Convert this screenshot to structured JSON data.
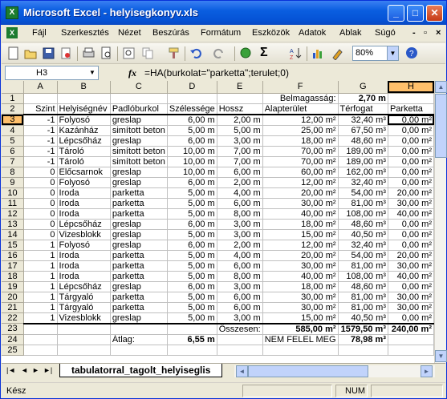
{
  "window": {
    "title": "Microsoft Excel - helyisegkonyv.xls",
    "app_icon": "X"
  },
  "caption_buttons": {
    "minimize": "_",
    "maximize": "□",
    "close": "✕"
  },
  "menu": [
    {
      "label": "Fájl"
    },
    {
      "label": "Szerkesztés"
    },
    {
      "label": "Nézet"
    },
    {
      "label": "Beszúrás"
    },
    {
      "label": "Formátum"
    },
    {
      "label": "Eszközök"
    },
    {
      "label": "Adatok"
    },
    {
      "label": "Ablak"
    },
    {
      "label": "Súgó"
    }
  ],
  "menu_right": {
    "minimize": "-",
    "restore": "▫",
    "close": "×"
  },
  "toolbar": {
    "zoom": "80%",
    "sum_symbol": "Σ"
  },
  "formula_bar": {
    "name_box": "H3",
    "fx": "fx",
    "formula": "=HA(burkolat=\"parketta\";terulet;0)"
  },
  "columns": [
    "A",
    "B",
    "C",
    "D",
    "E",
    "F",
    "G",
    "H"
  ],
  "selected_cell": {
    "row": 3,
    "col": "H"
  },
  "rows": [
    {
      "n": "1",
      "cells": [
        "",
        "",
        "",
        "",
        "",
        "Belmagasság:",
        "2,70 m",
        ""
      ]
    },
    {
      "n": "2",
      "cells": [
        "Szint",
        "Helyiségnév",
        "Padlóburkol",
        "Szélessége",
        "Hossz",
        "Alapterület",
        "Térfogat",
        "Parketta"
      ]
    },
    {
      "n": "3",
      "cells": [
        "-1",
        "Folyosó",
        "greslap",
        "6,00 m",
        "2,00 m",
        "12,00 m²",
        "32,40 m³",
        "0,00 m²"
      ]
    },
    {
      "n": "4",
      "cells": [
        "-1",
        "Kazánház",
        "simított beton",
        "5,00 m",
        "5,00 m",
        "25,00 m²",
        "67,50 m³",
        "0,00 m²"
      ]
    },
    {
      "n": "5",
      "cells": [
        "-1",
        "Lépcsőház",
        "greslap",
        "6,00 m",
        "3,00 m",
        "18,00 m²",
        "48,60 m³",
        "0,00 m²"
      ]
    },
    {
      "n": "6",
      "cells": [
        "-1",
        "Tároló",
        "simított beton",
        "10,00 m",
        "7,00 m",
        "70,00 m²",
        "189,00 m³",
        "0,00 m²"
      ]
    },
    {
      "n": "7",
      "cells": [
        "-1",
        "Tároló",
        "simított beton",
        "10,00 m",
        "7,00 m",
        "70,00 m²",
        "189,00 m³",
        "0,00 m²"
      ]
    },
    {
      "n": "8",
      "cells": [
        "0",
        "Előcsarnok",
        "greslap",
        "10,00 m",
        "6,00 m",
        "60,00 m²",
        "162,00 m³",
        "0,00 m²"
      ]
    },
    {
      "n": "9",
      "cells": [
        "0",
        "Folyosó",
        "greslap",
        "6,00 m",
        "2,00 m",
        "12,00 m²",
        "32,40 m³",
        "0,00 m²"
      ]
    },
    {
      "n": "10",
      "cells": [
        "0",
        "Iroda",
        "parketta",
        "5,00 m",
        "4,00 m",
        "20,00 m²",
        "54,00 m³",
        "20,00 m²"
      ]
    },
    {
      "n": "11",
      "cells": [
        "0",
        "Iroda",
        "parketta",
        "5,00 m",
        "6,00 m",
        "30,00 m²",
        "81,00 m³",
        "30,00 m²"
      ]
    },
    {
      "n": "12",
      "cells": [
        "0",
        "Iroda",
        "parketta",
        "5,00 m",
        "8,00 m",
        "40,00 m²",
        "108,00 m³",
        "40,00 m²"
      ]
    },
    {
      "n": "13",
      "cells": [
        "0",
        "Lépcsőház",
        "greslap",
        "6,00 m",
        "3,00 m",
        "18,00 m²",
        "48,60 m³",
        "0,00 m²"
      ]
    },
    {
      "n": "14",
      "cells": [
        "0",
        "Vizesblokk",
        "greslap",
        "5,00 m",
        "3,00 m",
        "15,00 m²",
        "40,50 m³",
        "0,00 m²"
      ]
    },
    {
      "n": "15",
      "cells": [
        "1",
        "Folyosó",
        "greslap",
        "6,00 m",
        "2,00 m",
        "12,00 m²",
        "32,40 m³",
        "0,00 m²"
      ]
    },
    {
      "n": "16",
      "cells": [
        "1",
        "Iroda",
        "parketta",
        "5,00 m",
        "4,00 m",
        "20,00 m²",
        "54,00 m³",
        "20,00 m²"
      ]
    },
    {
      "n": "17",
      "cells": [
        "1",
        "Iroda",
        "parketta",
        "5,00 m",
        "6,00 m",
        "30,00 m²",
        "81,00 m³",
        "30,00 m²"
      ]
    },
    {
      "n": "18",
      "cells": [
        "1",
        "Iroda",
        "parketta",
        "5,00 m",
        "8,00 m",
        "40,00 m²",
        "108,00 m³",
        "40,00 m²"
      ]
    },
    {
      "n": "19",
      "cells": [
        "1",
        "Lépcsőház",
        "greslap",
        "6,00 m",
        "3,00 m",
        "18,00 m²",
        "48,60 m³",
        "0,00 m²"
      ]
    },
    {
      "n": "20",
      "cells": [
        "1",
        "Tárgyaló",
        "parketta",
        "5,00 m",
        "6,00 m",
        "30,00 m²",
        "81,00 m³",
        "30,00 m²"
      ]
    },
    {
      "n": "21",
      "cells": [
        "1",
        "Tárgyaló",
        "parketta",
        "5,00 m",
        "6,00 m",
        "30,00 m²",
        "81,00 m³",
        "30,00 m²"
      ]
    },
    {
      "n": "22",
      "cells": [
        "1",
        "Vizesblokk",
        "greslap",
        "5,00 m",
        "3,00 m",
        "15,00 m²",
        "40,50 m³",
        "0,00 m²"
      ]
    },
    {
      "n": "23",
      "cells": [
        "",
        "",
        "",
        "",
        "Összesen:",
        "585,00 m²",
        "1579,50 m³",
        "240,00 m²"
      ]
    },
    {
      "n": "24",
      "cells": [
        "",
        "",
        "Átlag:",
        "6,55 m",
        "",
        "NEM FELEL MEG",
        "78,98 m³",
        ""
      ]
    },
    {
      "n": "25",
      "cells": [
        "",
        "",
        "",
        "",
        "",
        "",
        "",
        ""
      ]
    }
  ],
  "sheet_tab": "tabulatorral_tagolt_helyiseglis",
  "tab_nav": {
    "first": "|◄",
    "prev": "◄",
    "next": "►",
    "last": "►|"
  },
  "status": {
    "text": "Kész",
    "num": "NUM"
  }
}
